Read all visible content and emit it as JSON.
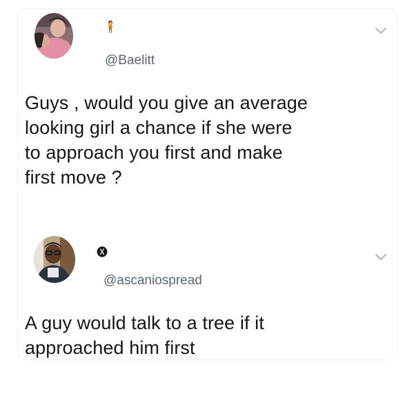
{
  "tweets": [
    {
      "name": "🧍",
      "handle": "@Baelitt",
      "text": "Guys , would you give an average\nlooking girl a chance if she were\nto approach you first and make\nfirst move ?",
      "avatar_icon": "profile-photo-woman",
      "menu_icon": "chevron-down-icon"
    },
    {
      "name": "🅧",
      "handle": "@ascaniospread",
      "text": "A guy would talk to a tree if it\napproached him first",
      "avatar_icon": "profile-photo-man",
      "menu_icon": "chevron-down-icon"
    }
  ],
  "colors": {
    "text": "#14171a",
    "handle": "#5b6670",
    "chevron": "#aab8c2",
    "border": "#eef0f2"
  }
}
